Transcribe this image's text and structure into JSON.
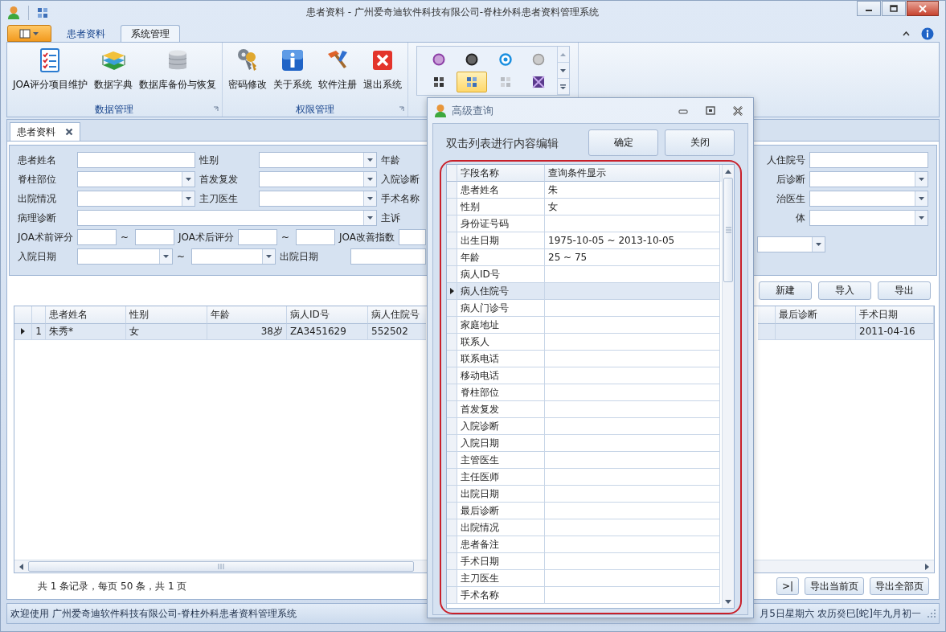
{
  "window": {
    "title": "患者资料 - 广州爱奇迪软件科技有限公司-脊柱外科患者资料管理系统"
  },
  "ribbon": {
    "tabs": [
      {
        "label": "患者资料",
        "selected": false
      },
      {
        "label": "系统管理",
        "selected": true
      }
    ],
    "groups": [
      {
        "title": "数据管理",
        "buttons": [
          {
            "label": "JOA评分项目维护",
            "kind": "checklist"
          },
          {
            "label": "数据字典",
            "kind": "books"
          },
          {
            "label": "数据库备份与恢复",
            "kind": "database"
          }
        ]
      },
      {
        "title": "权限管理",
        "buttons": [
          {
            "label": "密码修改",
            "kind": "keys"
          },
          {
            "label": "关于系统",
            "kind": "info"
          },
          {
            "label": "软件注册",
            "kind": "hammer"
          },
          {
            "label": "退出系统",
            "kind": "exit"
          }
        ]
      }
    ],
    "gallery": [
      {
        "kind": "purple-disc",
        "selected": false
      },
      {
        "kind": "dark-disc",
        "selected": false
      },
      {
        "kind": "blue-disc",
        "selected": false
      },
      {
        "kind": "gray-disc",
        "selected": false
      },
      {
        "kind": "dark-tiles",
        "selected": false
      },
      {
        "kind": "blue-tiles",
        "selected": true
      },
      {
        "kind": "gray-tiles",
        "selected": false
      },
      {
        "kind": "purple-cross",
        "selected": false
      }
    ]
  },
  "document_tabs": [
    {
      "label": "患者资料",
      "selected": true
    }
  ],
  "search_form": {
    "left_rows": [
      [
        {
          "kind": "label",
          "text": "患者姓名"
        },
        {
          "kind": "text"
        },
        {
          "kind": "label",
          "text": "性别"
        },
        {
          "kind": "combo"
        },
        {
          "kind": "label",
          "text": "年龄"
        }
      ],
      [
        {
          "kind": "label",
          "text": "脊柱部位"
        },
        {
          "kind": "combo"
        },
        {
          "kind": "label",
          "text": "首发复发"
        },
        {
          "kind": "combo"
        },
        {
          "kind": "label",
          "text": "入院诊断"
        }
      ],
      [
        {
          "kind": "label",
          "text": "出院情况"
        },
        {
          "kind": "combo"
        },
        {
          "kind": "label",
          "text": "主刀医生"
        },
        {
          "kind": "combo"
        },
        {
          "kind": "label",
          "text": "手术名称"
        }
      ],
      [
        {
          "kind": "label",
          "text": "病理诊断"
        },
        {
          "kind": "combo"
        },
        {
          "kind": "label",
          "text": "主诉"
        }
      ],
      [
        {
          "kind": "label",
          "text": "JOA术前评分"
        },
        {
          "kind": "text"
        },
        {
          "kind": "tilde",
          "text": "~"
        },
        {
          "kind": "text"
        },
        {
          "kind": "label",
          "text": "JOA术后评分"
        },
        {
          "kind": "text"
        },
        {
          "kind": "tilde",
          "text": "~"
        },
        {
          "kind": "text"
        },
        {
          "kind": "label",
          "text": "JOA改善指数"
        },
        {
          "kind": "text"
        }
      ],
      [
        {
          "kind": "label",
          "text": "入院日期"
        },
        {
          "kind": "combo"
        },
        {
          "kind": "tilde",
          "text": "~"
        },
        {
          "kind": "combo"
        },
        {
          "kind": "label",
          "text": "出院日期"
        },
        {
          "kind": "text"
        }
      ]
    ],
    "right_rows": [
      [
        {
          "kind": "label",
          "text": "人住院号"
        },
        {
          "kind": "text"
        }
      ],
      [
        {
          "kind": "label",
          "text": "后诊断"
        },
        {
          "kind": "combo"
        }
      ],
      [
        {
          "kind": "label",
          "text": "治医生"
        },
        {
          "kind": "combo"
        }
      ],
      [
        {
          "kind": "label",
          "text": "体"
        },
        {
          "kind": "combo"
        }
      ],
      [
        {
          "kind": "combo"
        }
      ]
    ]
  },
  "actions": [
    "新建",
    "导入",
    "导出"
  ],
  "table": {
    "columns": [
      "患者姓名",
      "性别",
      "年龄",
      "病人ID号",
      "病人住院号",
      "最后诊断",
      "手术日期"
    ],
    "rows": [
      {
        "number": "1",
        "selected": true,
        "cells": [
          {
            "text": "朱秀*"
          },
          {
            "text": "女"
          },
          {
            "text": "38岁"
          },
          {
            "text": "ZA3451629"
          },
          {
            "text": "552502"
          },
          {},
          {
            "text": "2011-04-16"
          }
        ]
      }
    ]
  },
  "pager": {
    "summary": "共 1 条记录，每页 50 条，共 1 页",
    "buttons": [
      ">|",
      "导出当前页",
      "导出全部页"
    ]
  },
  "status_bar": {
    "left": "欢迎使用 广州爱奇迪软件科技有限公司-脊柱外科患者资料管理系统",
    "right": "月5日星期六 农历癸巳[蛇]年九月初一"
  },
  "dialog": {
    "title": "高级查询",
    "hint": "双击列表进行内容编辑",
    "buttons": [
      "确定",
      "关闭"
    ],
    "columns": [
      "字段名称",
      "查询条件显示"
    ],
    "rows": [
      {
        "field": "患者姓名",
        "value": "朱",
        "selected": false
      },
      {
        "field": "性别",
        "value": "女",
        "selected": false
      },
      {
        "field": "身份证号码",
        "selected": false
      },
      {
        "field": "出生日期",
        "value": "1975-10-05 ~ 2013-10-05",
        "selected": false
      },
      {
        "field": "年龄",
        "value": "25 ~ 75",
        "selected": false
      },
      {
        "field": "病人ID号",
        "selected": false
      },
      {
        "field": "病人住院号",
        "selected": true
      },
      {
        "field": "病人门诊号",
        "selected": false
      },
      {
        "field": "家庭地址",
        "selected": false
      },
      {
        "field": "联系人",
        "selected": false
      },
      {
        "field": "联系电话",
        "selected": false
      },
      {
        "field": "移动电话",
        "selected": false
      },
      {
        "field": "脊柱部位",
        "selected": false
      },
      {
        "field": "首发复发",
        "selected": false
      },
      {
        "field": "入院诊断",
        "selected": false
      },
      {
        "field": "入院日期",
        "selected": false
      },
      {
        "field": "主管医生",
        "selected": false
      },
      {
        "field": "主任医师",
        "selected": false
      },
      {
        "field": "出院日期",
        "selected": false
      },
      {
        "field": "最后诊断",
        "selected": false
      },
      {
        "field": "出院情况",
        "selected": false
      },
      {
        "field": "患者备注",
        "selected": false
      },
      {
        "field": "手术日期",
        "selected": false
      },
      {
        "field": "主刀医生",
        "selected": false
      },
      {
        "field": "手术名称",
        "selected": false
      }
    ]
  }
}
